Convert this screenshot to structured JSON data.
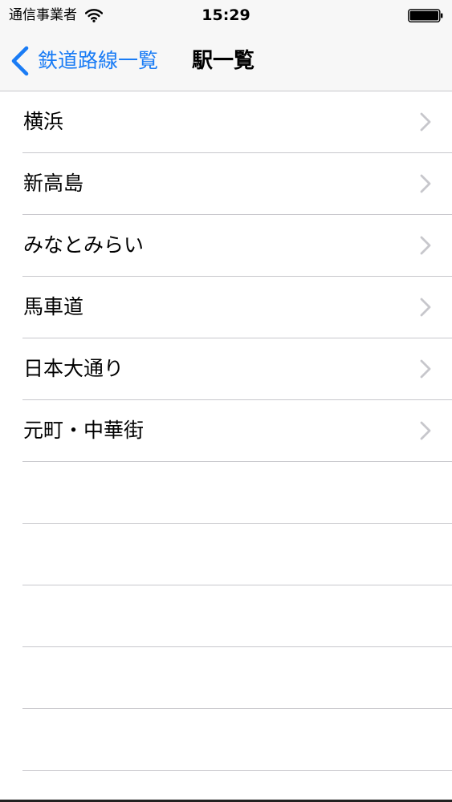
{
  "status_bar": {
    "carrier": "通信事業者",
    "time": "15:29",
    "wifi_icon": "wifi-icon",
    "battery_icon": "battery-full-icon"
  },
  "nav_bar": {
    "back_label": "鉄道路線一覧",
    "title": "駅一覧",
    "back_icon": "chevron-left-icon",
    "accent_color": "#1a7cf5"
  },
  "stations": [
    {
      "label": "横浜"
    },
    {
      "label": "新高島"
    },
    {
      "label": "みなとみらい"
    },
    {
      "label": "馬車道"
    },
    {
      "label": "日本大通り"
    },
    {
      "label": "元町・中華街"
    }
  ],
  "row_disclosure_icon": "chevron-right-icon",
  "colors": {
    "navbar_background": "#f7f7f7",
    "separator": "#c8c7cc",
    "disclosure": "#c7c7cc"
  }
}
